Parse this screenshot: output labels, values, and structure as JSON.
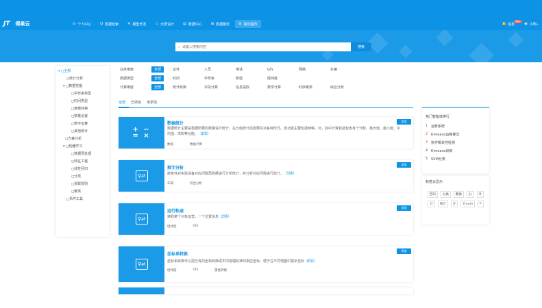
{
  "app": {
    "logo_mark": "JT",
    "name": "得果云"
  },
  "nav": [
    {
      "icon": "⊙",
      "label": "个人中心"
    },
    {
      "icon": "Q",
      "label": "数据检索"
    },
    {
      "icon": "✲",
      "label": "模型开发"
    },
    {
      "icon": "▭",
      "label": "大屏设计"
    },
    {
      "icon": "▤",
      "label": "数据中心"
    },
    {
      "icon": "⊞",
      "label": "数据服务"
    },
    {
      "icon": "⚙",
      "label": "算法超市"
    }
  ],
  "user": {
    "bell_label": "消息",
    "badge": "99+",
    "name": "小明"
  },
  "search": {
    "placeholder": "请输入搜索内容",
    "button": "搜索"
  },
  "tree": [
    {
      "label": "▾ ◻全部",
      "indent": 4,
      "active": true
    },
    {
      "label": "◻统计分析",
      "indent": 16
    },
    {
      "label": "▾ ◻数据挖掘",
      "indent": 11
    },
    {
      "label": "◻字符串类型",
      "indent": 23
    },
    {
      "label": "◻时间类型",
      "indent": 23
    },
    {
      "label": "◻离散转换",
      "indent": 23
    },
    {
      "label": "◻数量设置",
      "indent": 23
    },
    {
      "label": "◻数字运算",
      "indent": 23
    },
    {
      "label": "◻其他统计",
      "indent": 23
    },
    {
      "label": "◻方差分析",
      "indent": 14
    },
    {
      "label": "▾ ◻机器学习",
      "indent": 11
    },
    {
      "label": "◻数据预处理",
      "indent": 23
    },
    {
      "label": "◻特征工程",
      "indent": 23
    },
    {
      "label": "◻线性回归",
      "indent": 23
    },
    {
      "label": "◻分类",
      "indent": 23
    },
    {
      "label": "◻关联规则",
      "indent": 23
    },
    {
      "label": "◻聚类",
      "indent": 23
    },
    {
      "label": "◻事件工具",
      "indent": 16
    }
  ],
  "filters": [
    {
      "label": "业务维度",
      "all": "全部",
      "options": [
        "证件",
        "人员",
        "电话",
        "GIS",
        "网络",
        "车辆"
      ]
    },
    {
      "label": "数据类型",
      "all": "全部",
      "options": [
        "时间",
        "字符串",
        "数值",
        "经纬度"
      ]
    },
    {
      "label": "计算维度",
      "all": "全部",
      "options": [
        "统计转换",
        "字段计算",
        "信息提取",
        "数学计算",
        "时序聚类",
        "综合分析"
      ]
    }
  ],
  "tabs": [
    "全部",
    "已添加",
    "未添加"
  ],
  "cards": [
    {
      "title": "数据统计",
      "desc": "数据统计主要是根据所要的数量进行统计，在分组统计前需要先对各种形式。该功能主要包括两种。对，其中计算包括包含有个计数、最大值、最小值、平均值、求和等功能。",
      "more": "详情》",
      "tags": [
        "数值",
        "数据计算"
      ],
      "button": "添加"
    },
    {
      "title": "推字分析",
      "desc": "按条件对实验设备对应问题再数据进行分析统计，并分析对应问题进行统计。",
      "more": "详情》",
      "tags": [
        "车辆",
        "综合分析"
      ],
      "button": "添加"
    },
    {
      "title": "运行轨迹",
      "desc": "获取某个对象运营，一个位置信息",
      "more": "详情》",
      "tags": [
        "经纬度",
        "GIS"
      ],
      "button": "添加"
    },
    {
      "title": "坐标系转换",
      "desc": "坐标系转换可以把已有的坐标转换成不同地理标准的相应坐标，便于在不同地图中展示坐标",
      "more": "详情》",
      "tags": [
        "经纬度",
        "GIS",
        "属性转换"
      ],
      "button": "添加"
    }
  ],
  "hot": {
    "title": "热门智能体排行",
    "items": [
      "台账系统",
      "K-means运算算法",
      "协作相关性检测",
      "K-means训练",
      "SVM分类"
    ]
  },
  "tag_cloud": {
    "title": "标签云显示",
    "tags": [
      "回归",
      "分类",
      "聚类",
      "分",
      "计",
      "计",
      "统计",
      "计",
      "计num",
      "k"
    ]
  },
  "colors": {
    "primary": "#0d93e6",
    "hero": "#1b9ae8",
    "rank_accent": "#e05a2b"
  }
}
